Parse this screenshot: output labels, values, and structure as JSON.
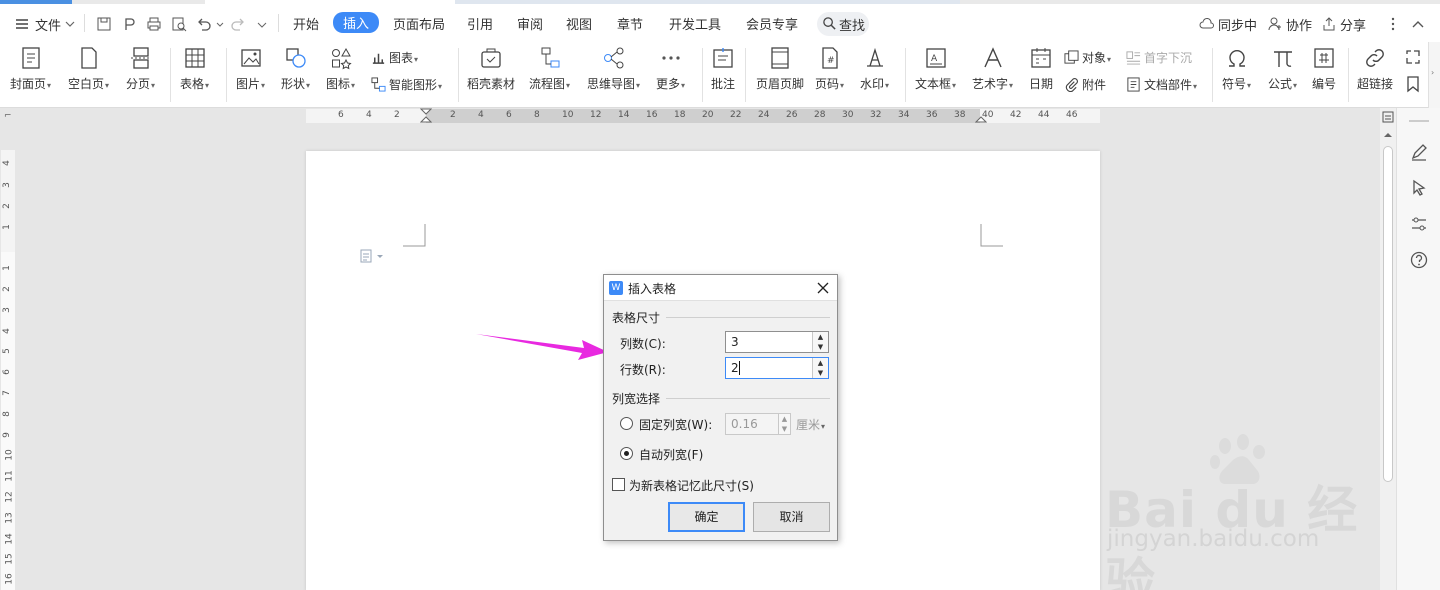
{
  "menubar": {
    "file_label": "文件",
    "tabs": [
      {
        "label": "开始",
        "active": false
      },
      {
        "label": "插入",
        "active": true
      },
      {
        "label": "页面布局",
        "active": false
      },
      {
        "label": "引用",
        "active": false
      },
      {
        "label": "审阅",
        "active": false
      },
      {
        "label": "视图",
        "active": false
      },
      {
        "label": "章节",
        "active": false
      },
      {
        "label": "开发工具",
        "active": false
      },
      {
        "label": "会员专享",
        "active": false
      }
    ],
    "search_label": "查找",
    "right": {
      "sync": "同步中",
      "collab": "协作",
      "share": "分享"
    }
  },
  "ribbon": {
    "cover": "封面页",
    "blank": "空白页",
    "pagebreak": "分页",
    "table": "表格",
    "picture": "图片",
    "shape": "形状",
    "icon": "图标",
    "chart": "图表",
    "smartart": "智能图形",
    "docer": "稻壳素材",
    "flowchart": "流程图",
    "mindmap": "思维导图",
    "more": "更多",
    "comment": "批注",
    "header_footer": "页眉页脚",
    "page_number": "页码",
    "watermark": "水印",
    "textbox": "文本框",
    "wordart": "艺术字",
    "date": "日期",
    "object": "对象",
    "attachment": "附件",
    "dropcap": "首字下沉",
    "docparts": "文档部件",
    "symbol": "符号",
    "formula": "公式",
    "numbering": "编号",
    "hyperlink": "超链接"
  },
  "ruler": {
    "h_numbers": [
      "6",
      "4",
      "2",
      "2",
      "4",
      "6",
      "8",
      "10",
      "12",
      "14",
      "16",
      "18",
      "20",
      "22",
      "24",
      "26",
      "28",
      "30",
      "32",
      "34",
      "36",
      "38",
      "40",
      "42",
      "44",
      "46"
    ],
    "v_numbers": [
      "4",
      "3",
      "2",
      "1",
      "1",
      "2",
      "3",
      "4",
      "5",
      "6",
      "7",
      "8",
      "9",
      "10",
      "11",
      "12",
      "13",
      "14",
      "15",
      "16"
    ]
  },
  "dialog": {
    "title": "插入表格",
    "section_size": "表格尺寸",
    "cols_label": "列数(C):",
    "cols_value": "3",
    "rows_label": "行数(R):",
    "rows_value": "2",
    "section_width": "列宽选择",
    "fixed_width_label": "固定列宽(W):",
    "fixed_width_value": "0.16",
    "unit_label": "厘米",
    "auto_width_label": "自动列宽(F)",
    "remember_label": "为新表格记忆此尺寸(S)",
    "ok_label": "确定",
    "cancel_label": "取消",
    "auto_width_selected": true,
    "remember_checked": false
  },
  "watermark": {
    "brand": "Bai du 经验",
    "url": "jingyan.baidu.com"
  },
  "colors": {
    "accent": "#3d8af7",
    "annotation_arrow": "#e829e0"
  }
}
